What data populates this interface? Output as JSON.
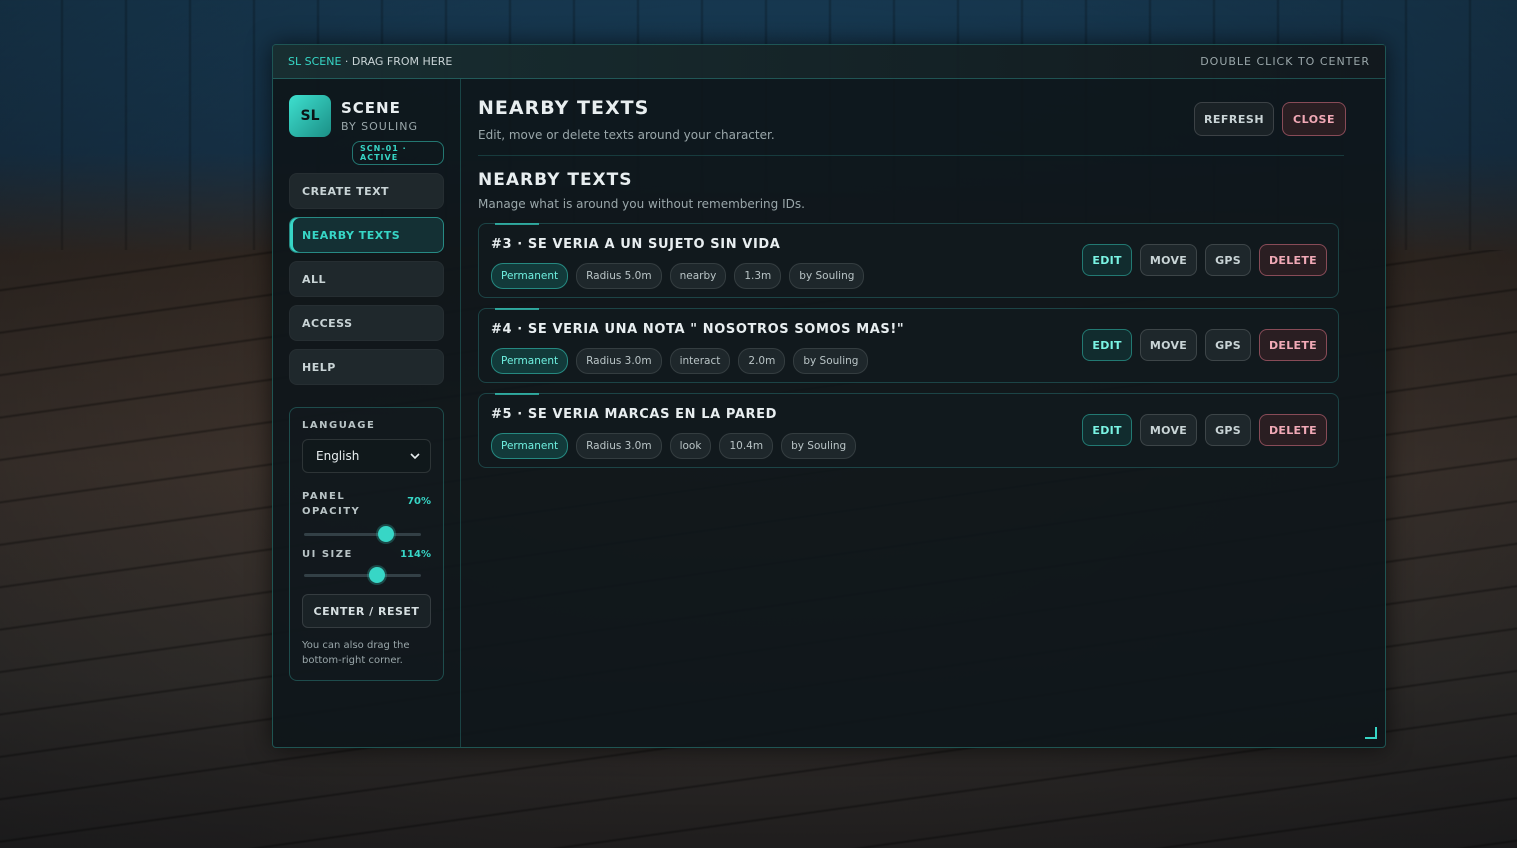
{
  "titlebar": {
    "brand": "SL SCENE",
    "drag_hint": " · DRAG FROM HERE",
    "center_hint": "DOUBLE CLICK TO CENTER"
  },
  "sidebar": {
    "logo_text": "SL",
    "title": "SCENE",
    "subtitle": "BY SOULING",
    "status_badge": "SCN-01 · ACTIVE",
    "nav": [
      {
        "label": "CREATE TEXT"
      },
      {
        "label": "NEARBY TEXTS"
      },
      {
        "label": "ALL"
      },
      {
        "label": "ACCESS"
      },
      {
        "label": "HELP"
      }
    ],
    "settings": {
      "language_label": "LANGUAGE",
      "language_value": "English",
      "opacity_label": "PANEL OPACITY",
      "opacity_value": "70%",
      "opacity_fraction": 0.7,
      "ui_size_label": "UI SIZE",
      "ui_size_value": "114%",
      "ui_size_fraction": 0.62,
      "reset_label": "CENTER / RESET",
      "note": "You can also drag the bottom-right corner."
    }
  },
  "header": {
    "title": "NEARBY TEXTS",
    "subtitle": "Edit, move or delete texts around your character.",
    "refresh_label": "REFRESH",
    "close_label": "CLOSE"
  },
  "section": {
    "title": "NEARBY TEXTS",
    "subtitle": "Manage what is around you without remembering IDs."
  },
  "actions": {
    "edit": "EDIT",
    "move": "MOVE",
    "gps": "GPS",
    "delete": "DELETE"
  },
  "texts": [
    {
      "title": "#3 · SE VERIA A UN SUJETO SIN VIDA",
      "tags": [
        "Permanent",
        "Radius 5.0m",
        "nearby",
        "1.3m",
        "by Souling"
      ]
    },
    {
      "title": "#4 · SE VERIA UNA NOTA \" NOSOTROS SOMOS MAS!\"",
      "tags": [
        "Permanent",
        "Radius 3.0m",
        "interact",
        "2.0m",
        "by Souling"
      ]
    },
    {
      "title": "#5 · SE VERIA MARCAS EN LA PARED",
      "tags": [
        "Permanent",
        "Radius 3.0m",
        "look",
        "10.4m",
        "by Souling"
      ]
    }
  ],
  "colors": {
    "accent": "#37d6c6",
    "danger": "#f1a9b6"
  },
  "icons": {
    "scroll_up": "▲",
    "scroll_down": "▼",
    "select_chevron": "⌄"
  }
}
